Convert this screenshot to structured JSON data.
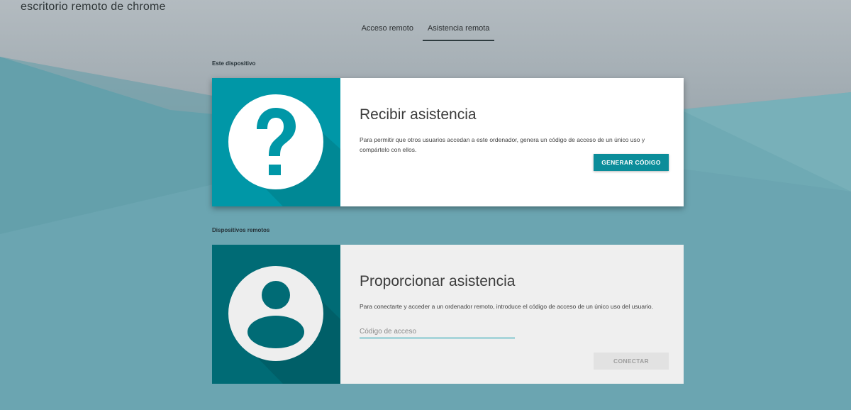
{
  "header": {
    "app_title": "escritorio remoto de chrome"
  },
  "tabs": [
    {
      "label": "Acceso remoto",
      "active": false
    },
    {
      "label": "Asistencia remota",
      "active": true
    }
  ],
  "this_device": {
    "section_label": "Este dispositivo",
    "icon": "question-mark-icon",
    "title": "Recibir asistencia",
    "description": "Para permitir que otros usuarios accedan a este ordenador, genera un código de acceso de un único uso y compártelo con ellos.",
    "button_label": "GENERAR CÓDIGO"
  },
  "remote_devices": {
    "section_label": "Dispositivos remotos",
    "icon": "person-icon",
    "title": "Proporcionar asistencia",
    "description": "Para conectarte y acceder a un ordenador remoto, introduce el código de acceso de un único uso del usuario.",
    "input_value": "",
    "input_placeholder": "Código de acceso",
    "button_label": "CONECTAR"
  },
  "colors": {
    "accent": "#0097a7",
    "accent_dark": "#006b75",
    "background_teal": "#6fa8b3",
    "header_gray": "#b4bcc1"
  }
}
